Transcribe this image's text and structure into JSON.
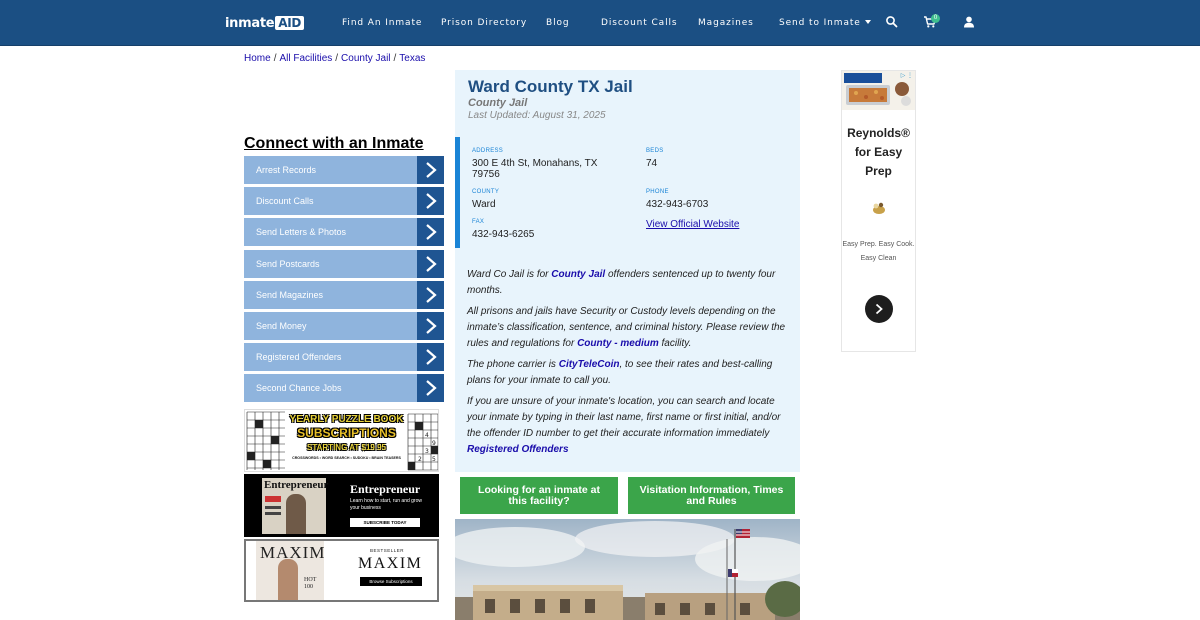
{
  "header": {
    "logo_main": "inmate",
    "logo_accent": "AID",
    "nav": [
      "Find An Inmate",
      "Prison Directory",
      "Blog",
      "Discount Calls",
      "Magazines",
      "Send to Inmate"
    ],
    "cart_count": "0",
    "icons": [
      "search-icon",
      "cart-icon",
      "user-icon"
    ]
  },
  "breadcrumb": [
    "Home",
    "All Facilities",
    "County Jail",
    "Texas"
  ],
  "sidebar": {
    "title": "Connect with an Inmate",
    "items": [
      "Arrest Records",
      "Discount Calls",
      "Send Letters & Photos",
      "Send Postcards",
      "Send Magazines",
      "Send Money",
      "Registered Offenders",
      "Second Chance Jobs"
    ],
    "promos": {
      "puzzle": {
        "headline": "YEARLY PUZZLE BOOK",
        "headline2": "SUBSCRIPTIONS",
        "price": "STARTING AT $19.95",
        "tags": "CROSSWORDS • WORD SEARCH • SUDOKU • BRAIN TEASERS"
      },
      "entrepreneur": {
        "brand": "Entrepreneur",
        "tagline": "Learn how to start, run and grow your business",
        "cta": "SUBSCRIBE TODAY"
      },
      "maxim": {
        "brand": "MAXIM",
        "badge": "BESTSELLER",
        "cta": "Browse Subscriptions",
        "cover_text": "HOT 100"
      }
    }
  },
  "facility": {
    "name": "Ward County TX Jail",
    "type": "County Jail",
    "updated": "Last Updated: August 31, 2025",
    "address_label": "ADDRESS",
    "address": "300 E 4th St, Monahans, TX 79756",
    "beds_label": "BEDS",
    "beds": "74",
    "county_label": "COUNTY",
    "county": "Ward",
    "phone_label": "PHONE",
    "phone": "432-943-6703",
    "fax_label": "FAX",
    "fax": "432-943-6265",
    "website_link": "View Official Website"
  },
  "description": {
    "p1_a": "Ward Co Jail is for ",
    "p1_link": "County Jail",
    "p1_b": " offenders sentenced up to twenty four months.",
    "p2_a": "All prisons and jails have Security or Custody levels depending on the inmate’s classification, sentence, and criminal history. Please review the rules and regulations for ",
    "p2_link": "County - medium",
    "p2_b": " facility.",
    "p3_a": "The phone carrier is ",
    "p3_link": "CityTeleCoin",
    "p3_b": ", to see their rates and best-calling plans for your inmate to call you.",
    "p4_a": "If you are unsure of your inmate's location, you can search and locate your inmate by typing in their last name, first name or first initial, and/or the offender ID number to get their accurate information immediately ",
    "p4_link": "Registered Offenders"
  },
  "buttons": {
    "looking": "Looking for an inmate at this facility?",
    "visitation": "Visitation Information, Times and Rules"
  },
  "ad": {
    "title": "Reynolds® for Easy Prep",
    "text": "Easy Prep. Easy Cook. Easy Clean",
    "choices": "▷ ⋮"
  },
  "colors": {
    "navbar": "#1b4f83",
    "sidebar_item": "#8fb4dd",
    "sidebar_arrow": "#1f5592",
    "card_bg": "#e8f4fc",
    "accent_blue": "#1a84d6",
    "button_green": "#3ba54a"
  }
}
